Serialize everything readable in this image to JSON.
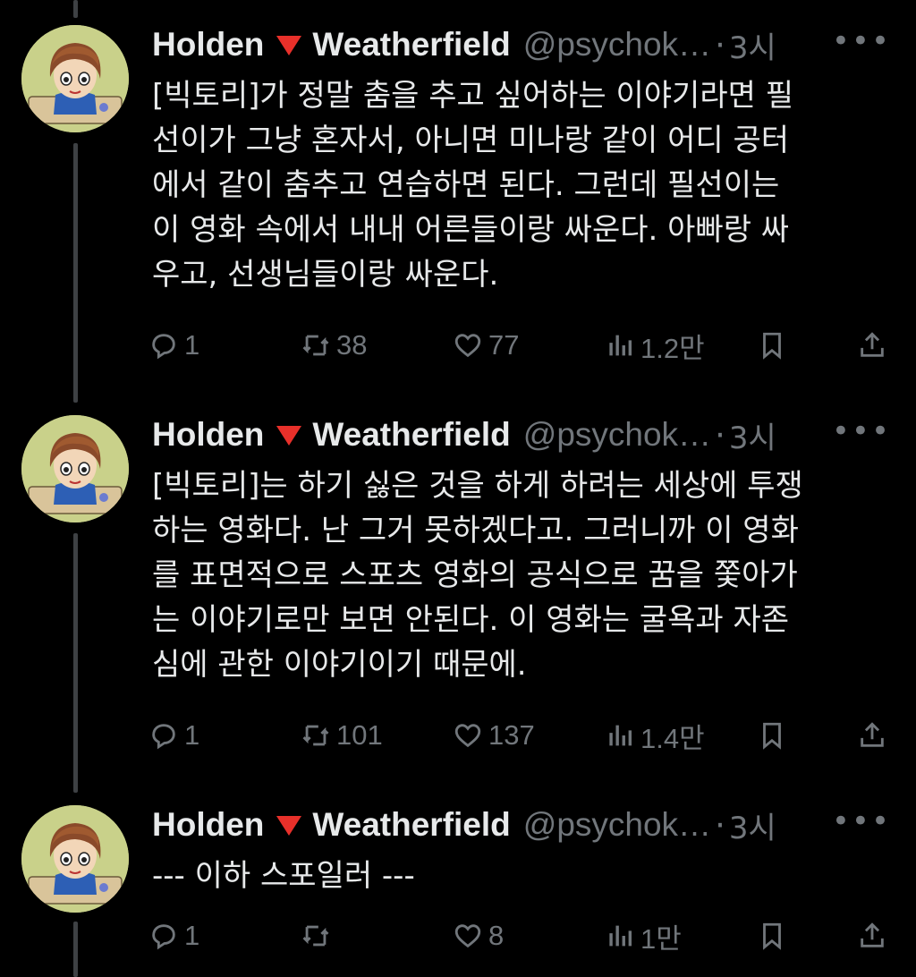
{
  "tweets": [
    {
      "author": "Holden",
      "author_suffix": "Weatherfield",
      "handle": "@psychok…",
      "separator": "·",
      "time": "3시",
      "more": "•••",
      "text": "[빅토리]가 정말 춤을 추고 싶어하는 이야기라면 필\n선이가 그냥 혼자서, 아니면 미나랑 같이 어디 공터\n에서 같이 춤추고 연습하면 된다. 그런데 필선이는\n이 영화 속에서 내내 어른들이랑 싸운다. 아빠랑 싸\n우고, 선생님들이랑 싸운다.",
      "replies": "1",
      "retweets": "38",
      "likes": "77",
      "views": "1.2만"
    },
    {
      "author": "Holden",
      "author_suffix": "Weatherfield",
      "handle": "@psychok…",
      "separator": "·",
      "time": "3시",
      "more": "•••",
      "text": "[빅토리]는 하기 싫은 것을 하게 하려는 세상에 투쟁\n하는 영화다. 난 그거 못하겠다고. 그러니까 이 영화\n를 표면적으로 스포츠 영화의 공식으로 꿈을 쫓아가\n는 이야기로만 보면 안된다. 이 영화는 굴욕과 자존\n심에 관한 이야기이기 때문에.",
      "replies": "1",
      "retweets": "101",
      "likes": "137",
      "views": "1.4만"
    },
    {
      "author": "Holden",
      "author_suffix": "Weatherfield",
      "handle": "@psychok…",
      "separator": "·",
      "time": "3시",
      "more": "•••",
      "text": "--- 이하 스포일러 ---",
      "replies": "1",
      "retweets": "",
      "likes": "8",
      "views": "1만"
    }
  ],
  "colors": {
    "background": "#000000",
    "text": "#e7e9ea",
    "muted": "#71767b",
    "thread_line": "#3e4144",
    "flag": "#e8302a"
  },
  "icons": [
    "reply-icon",
    "retweet-icon",
    "like-icon",
    "views-icon",
    "bookmark-icon",
    "share-icon",
    "red-triangle-emoji"
  ]
}
